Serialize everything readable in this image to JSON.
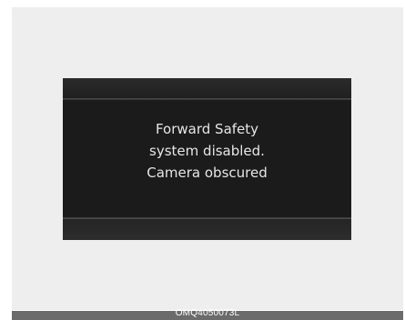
{
  "display": {
    "message_lines": [
      "Forward Safety",
      "system disabled.",
      "Camera obscured"
    ]
  },
  "footer": {
    "image_code": "OMQ4050073L"
  },
  "colors": {
    "background": "#eeeeef",
    "display_background": "#1b1b1b",
    "message_text": "#e6e6e6",
    "footer_bar": "#6b6b6b"
  }
}
